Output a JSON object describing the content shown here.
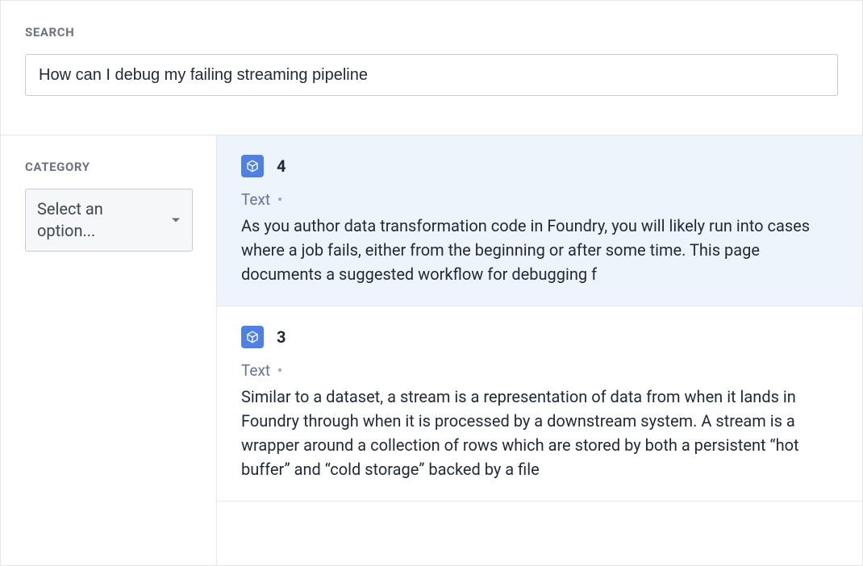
{
  "search": {
    "label": "SEARCH",
    "value": "How can I debug my failing streaming pipeline"
  },
  "sidebar": {
    "category_label": "CATEGORY",
    "select_placeholder": "Select an option..."
  },
  "results": [
    {
      "number": "4",
      "type_label": "Text",
      "text": "As you author data transformation code in Foundry, you will likely run into cases where a job fails, either from the beginning or after some time. This page documents a suggested workflow for debugging f",
      "selected": true
    },
    {
      "number": "3",
      "type_label": "Text",
      "text": "Similar to a dataset, a stream is a representation of data from when it lands in Foundry through when it is processed by a downstream system. A stream is a wrapper around a collection of rows which are stored by both a persistent “hot buffer” and “cold storage” backed by a file",
      "selected": false
    }
  ]
}
